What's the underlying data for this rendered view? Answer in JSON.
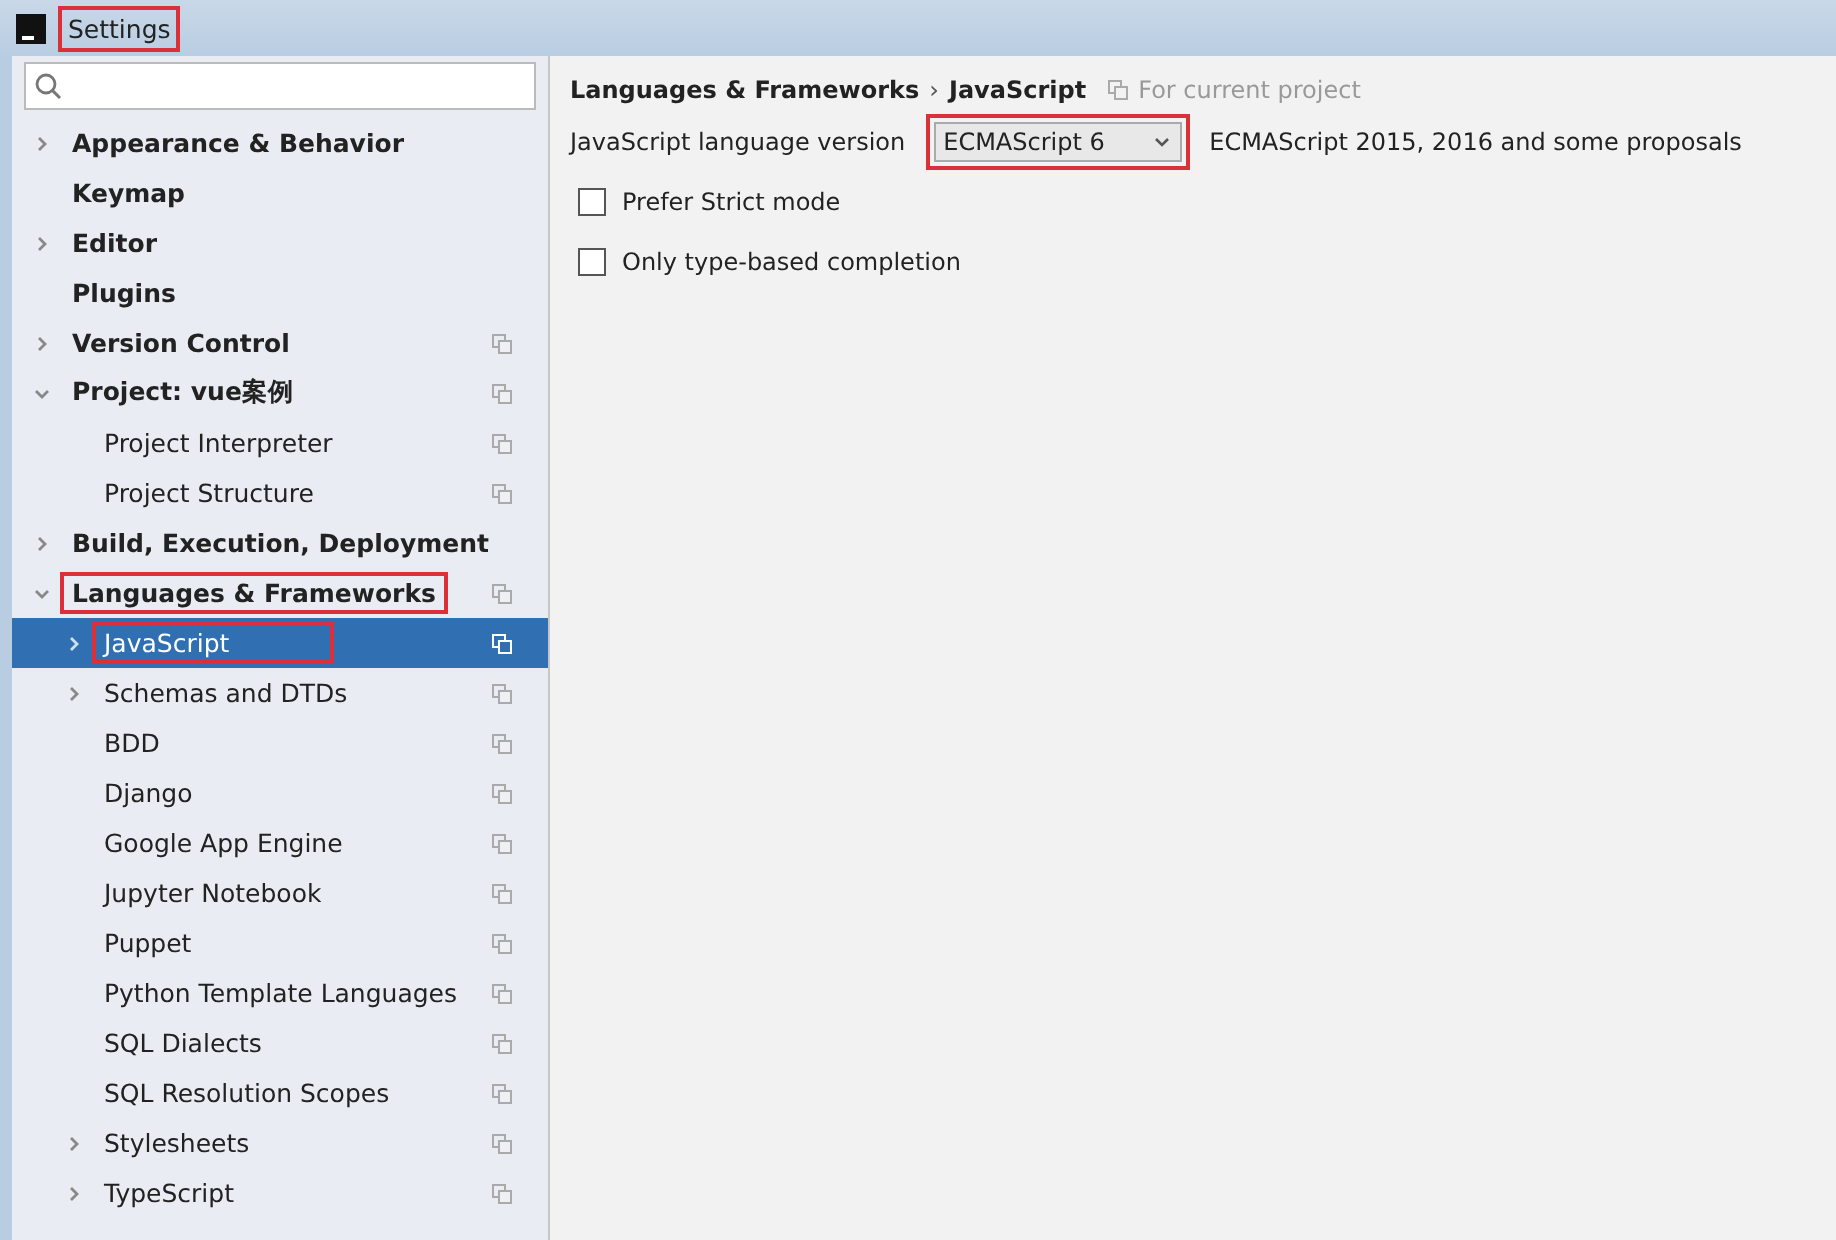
{
  "window": {
    "title": "Settings",
    "highlighted": true
  },
  "tree": [
    {
      "label": "Appearance & Behavior",
      "kind": "folder",
      "expanded": false,
      "scoped": false,
      "selected": false,
      "highlighted": false
    },
    {
      "label": "Keymap",
      "kind": "leaf",
      "scoped": false,
      "selected": false,
      "highlighted": false
    },
    {
      "label": "Editor",
      "kind": "folder",
      "expanded": false,
      "scoped": false,
      "selected": false,
      "highlighted": false
    },
    {
      "label": "Plugins",
      "kind": "leaf",
      "scoped": false,
      "selected": false,
      "highlighted": false
    },
    {
      "label": "Version Control",
      "kind": "folder",
      "expanded": false,
      "scoped": true,
      "selected": false,
      "highlighted": false
    },
    {
      "label": "Project: vue案例",
      "kind": "folder",
      "expanded": true,
      "scoped": true,
      "selected": false,
      "highlighted": false,
      "children": [
        {
          "label": "Project Interpreter",
          "kind": "leaf",
          "scoped": true,
          "selected": false,
          "highlighted": false
        },
        {
          "label": "Project Structure",
          "kind": "leaf",
          "scoped": true,
          "selected": false,
          "highlighted": false
        }
      ]
    },
    {
      "label": "Build, Execution, Deployment",
      "kind": "folder",
      "expanded": false,
      "scoped": false,
      "selected": false,
      "highlighted": false
    },
    {
      "label": "Languages & Frameworks",
      "kind": "folder",
      "expanded": true,
      "scoped": true,
      "selected": false,
      "highlighted": true,
      "children": [
        {
          "label": "JavaScript",
          "kind": "folder",
          "expanded": false,
          "scoped": true,
          "selected": true,
          "highlighted": true
        },
        {
          "label": "Schemas and DTDs",
          "kind": "folder",
          "expanded": false,
          "scoped": true,
          "selected": false,
          "highlighted": false
        },
        {
          "label": "BDD",
          "kind": "leaf",
          "scoped": true,
          "selected": false,
          "highlighted": false
        },
        {
          "label": "Django",
          "kind": "leaf",
          "scoped": true,
          "selected": false,
          "highlighted": false
        },
        {
          "label": "Google App Engine",
          "kind": "leaf",
          "scoped": true,
          "selected": false,
          "highlighted": false
        },
        {
          "label": "Jupyter Notebook",
          "kind": "leaf",
          "scoped": true,
          "selected": false,
          "highlighted": false
        },
        {
          "label": "Puppet",
          "kind": "leaf",
          "scoped": true,
          "selected": false,
          "highlighted": false
        },
        {
          "label": "Python Template Languages",
          "kind": "leaf",
          "scoped": true,
          "selected": false,
          "highlighted": false
        },
        {
          "label": "SQL Dialects",
          "kind": "leaf",
          "scoped": true,
          "selected": false,
          "highlighted": false
        },
        {
          "label": "SQL Resolution Scopes",
          "kind": "leaf",
          "scoped": true,
          "selected": false,
          "highlighted": false
        },
        {
          "label": "Stylesheets",
          "kind": "folder",
          "expanded": false,
          "scoped": true,
          "selected": false,
          "highlighted": false
        },
        {
          "label": "TypeScript",
          "kind": "folder",
          "expanded": false,
          "scoped": true,
          "selected": false,
          "highlighted": false
        }
      ]
    }
  ],
  "breadcrumb": [
    "Languages & Frameworks",
    "JavaScript"
  ],
  "breadcrumb_separator": "›",
  "scope_note": "For current project",
  "version": {
    "label": "JavaScript language version",
    "value": "ECMAScript 6",
    "highlighted": true,
    "description": "ECMAScript 2015, 2016 and some proposals"
  },
  "options": [
    {
      "label": "Prefer Strict mode",
      "checked": false
    },
    {
      "label": "Only type-based completion",
      "checked": false
    }
  ]
}
